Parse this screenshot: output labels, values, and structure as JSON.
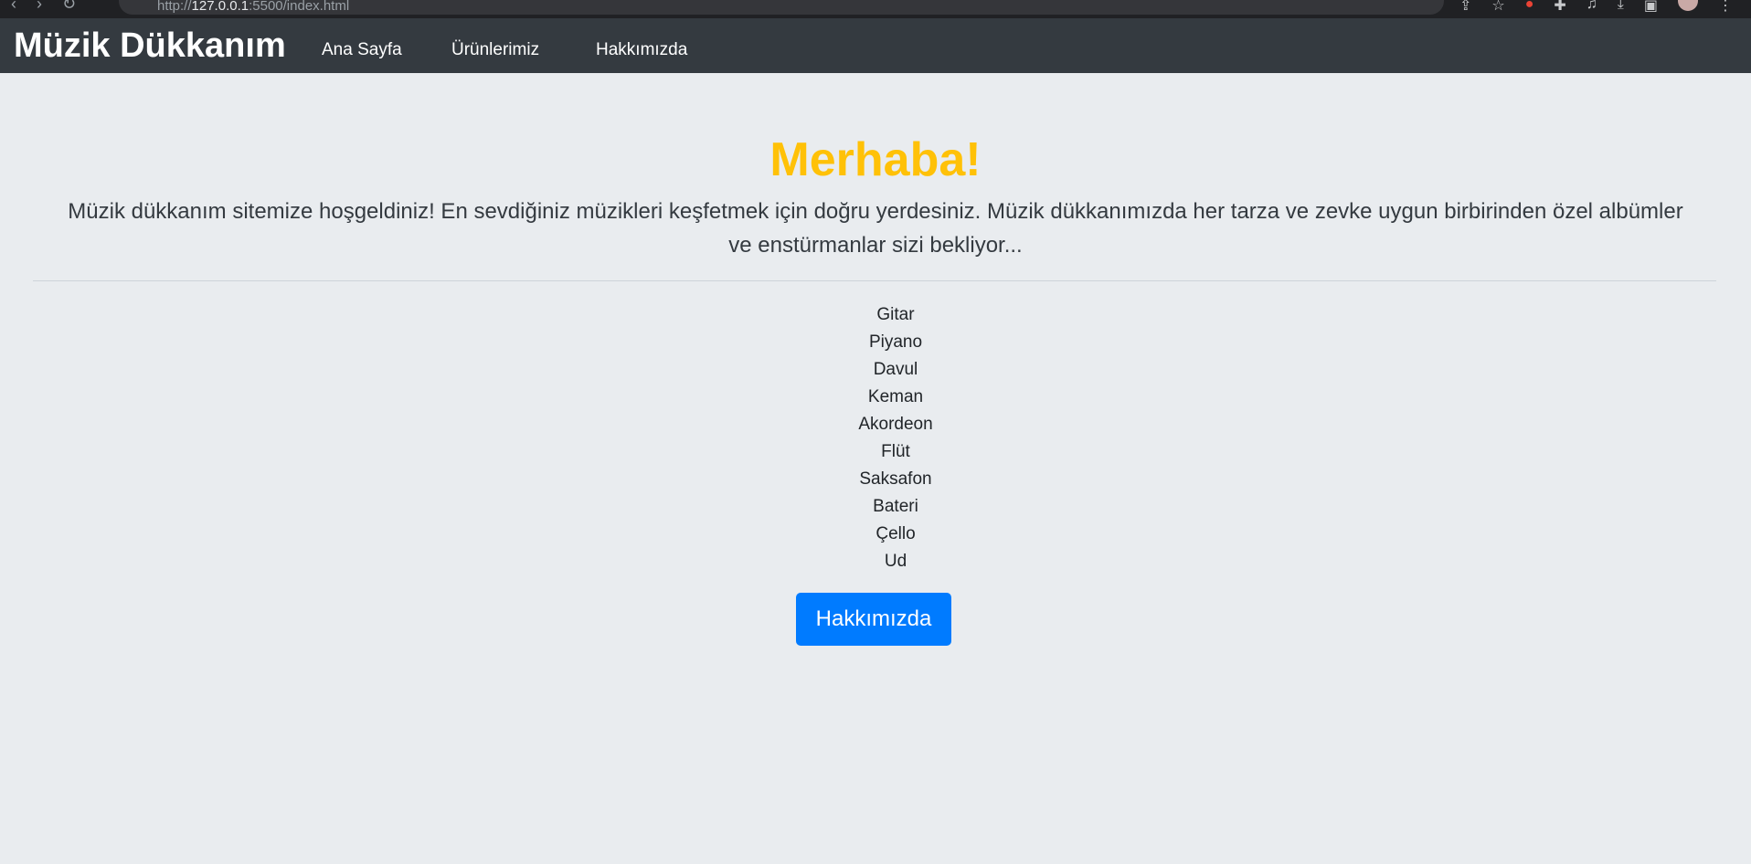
{
  "browser": {
    "url_prefix": "http://",
    "url_host": "127.0.0.1",
    "url_rest": ":5500/index.html",
    "icons": [
      "back-icon",
      "forward-icon",
      "reload-icon",
      "info-icon",
      "share-icon",
      "star-icon",
      "extension-icon",
      "puzzle-icon",
      "media-icon",
      "download-icon",
      "sidepanel-icon",
      "profile-icon",
      "menu-icon"
    ]
  },
  "navbar": {
    "brand": "Müzik Dükkanım",
    "links": [
      "Ana Sayfa",
      "Ürünlerimiz",
      "Hakkımızda"
    ]
  },
  "hero": {
    "title": "Merhaba!",
    "lead": "Müzik dükkanım sitemize hoşgeldiniz! En sevdiğiniz müzikleri keşfetmek için doğru yerdesiniz. Müzik dükkanımızda her tarza ve zevke uygun birbirinden özel albümler ve enstürmanlar sizi bekliyor...",
    "title_color": "#ffc107"
  },
  "instruments": [
    "Gitar",
    "Piyano",
    "Davul",
    "Keman",
    "Akordeon",
    "Flüt",
    "Saksafon",
    "Bateri",
    "Çello",
    "Ud"
  ],
  "button": {
    "label": "Hakkımızda",
    "color": "#007bff"
  }
}
